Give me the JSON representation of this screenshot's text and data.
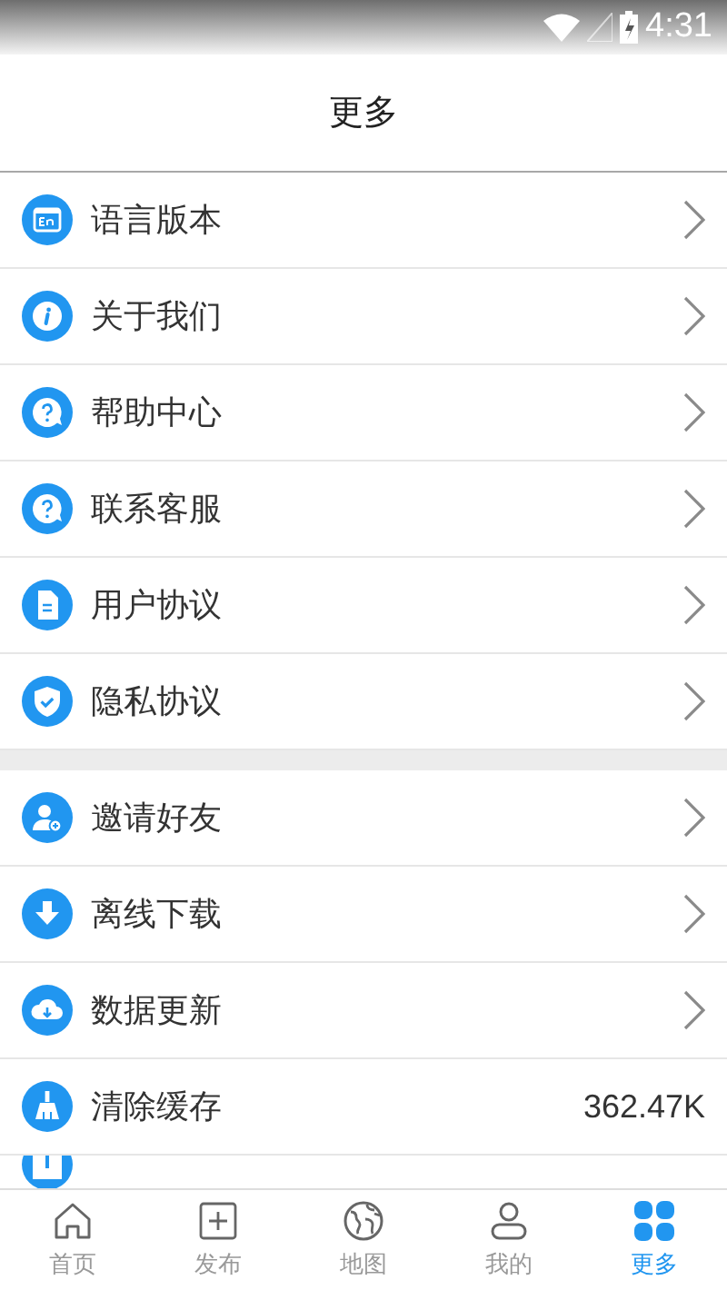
{
  "status_bar": {
    "time": "4:31"
  },
  "header": {
    "title": "更多"
  },
  "sections": [
    {
      "items": [
        {
          "kind": "link",
          "label": "语言版本"
        },
        {
          "kind": "link",
          "label": "关于我们"
        },
        {
          "kind": "link",
          "label": "帮助中心"
        },
        {
          "kind": "link",
          "label": "联系客服"
        },
        {
          "kind": "link",
          "label": "用户协议"
        },
        {
          "kind": "link",
          "label": "隐私协议"
        }
      ]
    },
    {
      "items": [
        {
          "kind": "link",
          "label": "邀请好友"
        },
        {
          "kind": "link",
          "label": "离线下载"
        },
        {
          "kind": "link",
          "label": "数据更新"
        },
        {
          "kind": "value",
          "label": "清除缓存",
          "value": "362.47K"
        },
        {
          "kind": "partial"
        }
      ]
    }
  ],
  "tab_bar": [
    {
      "label": "首页",
      "selected": false
    },
    {
      "label": "发布",
      "selected": false
    },
    {
      "label": "地图",
      "selected": false
    },
    {
      "label": "我的",
      "selected": false
    },
    {
      "label": "更多",
      "selected": true
    }
  ]
}
